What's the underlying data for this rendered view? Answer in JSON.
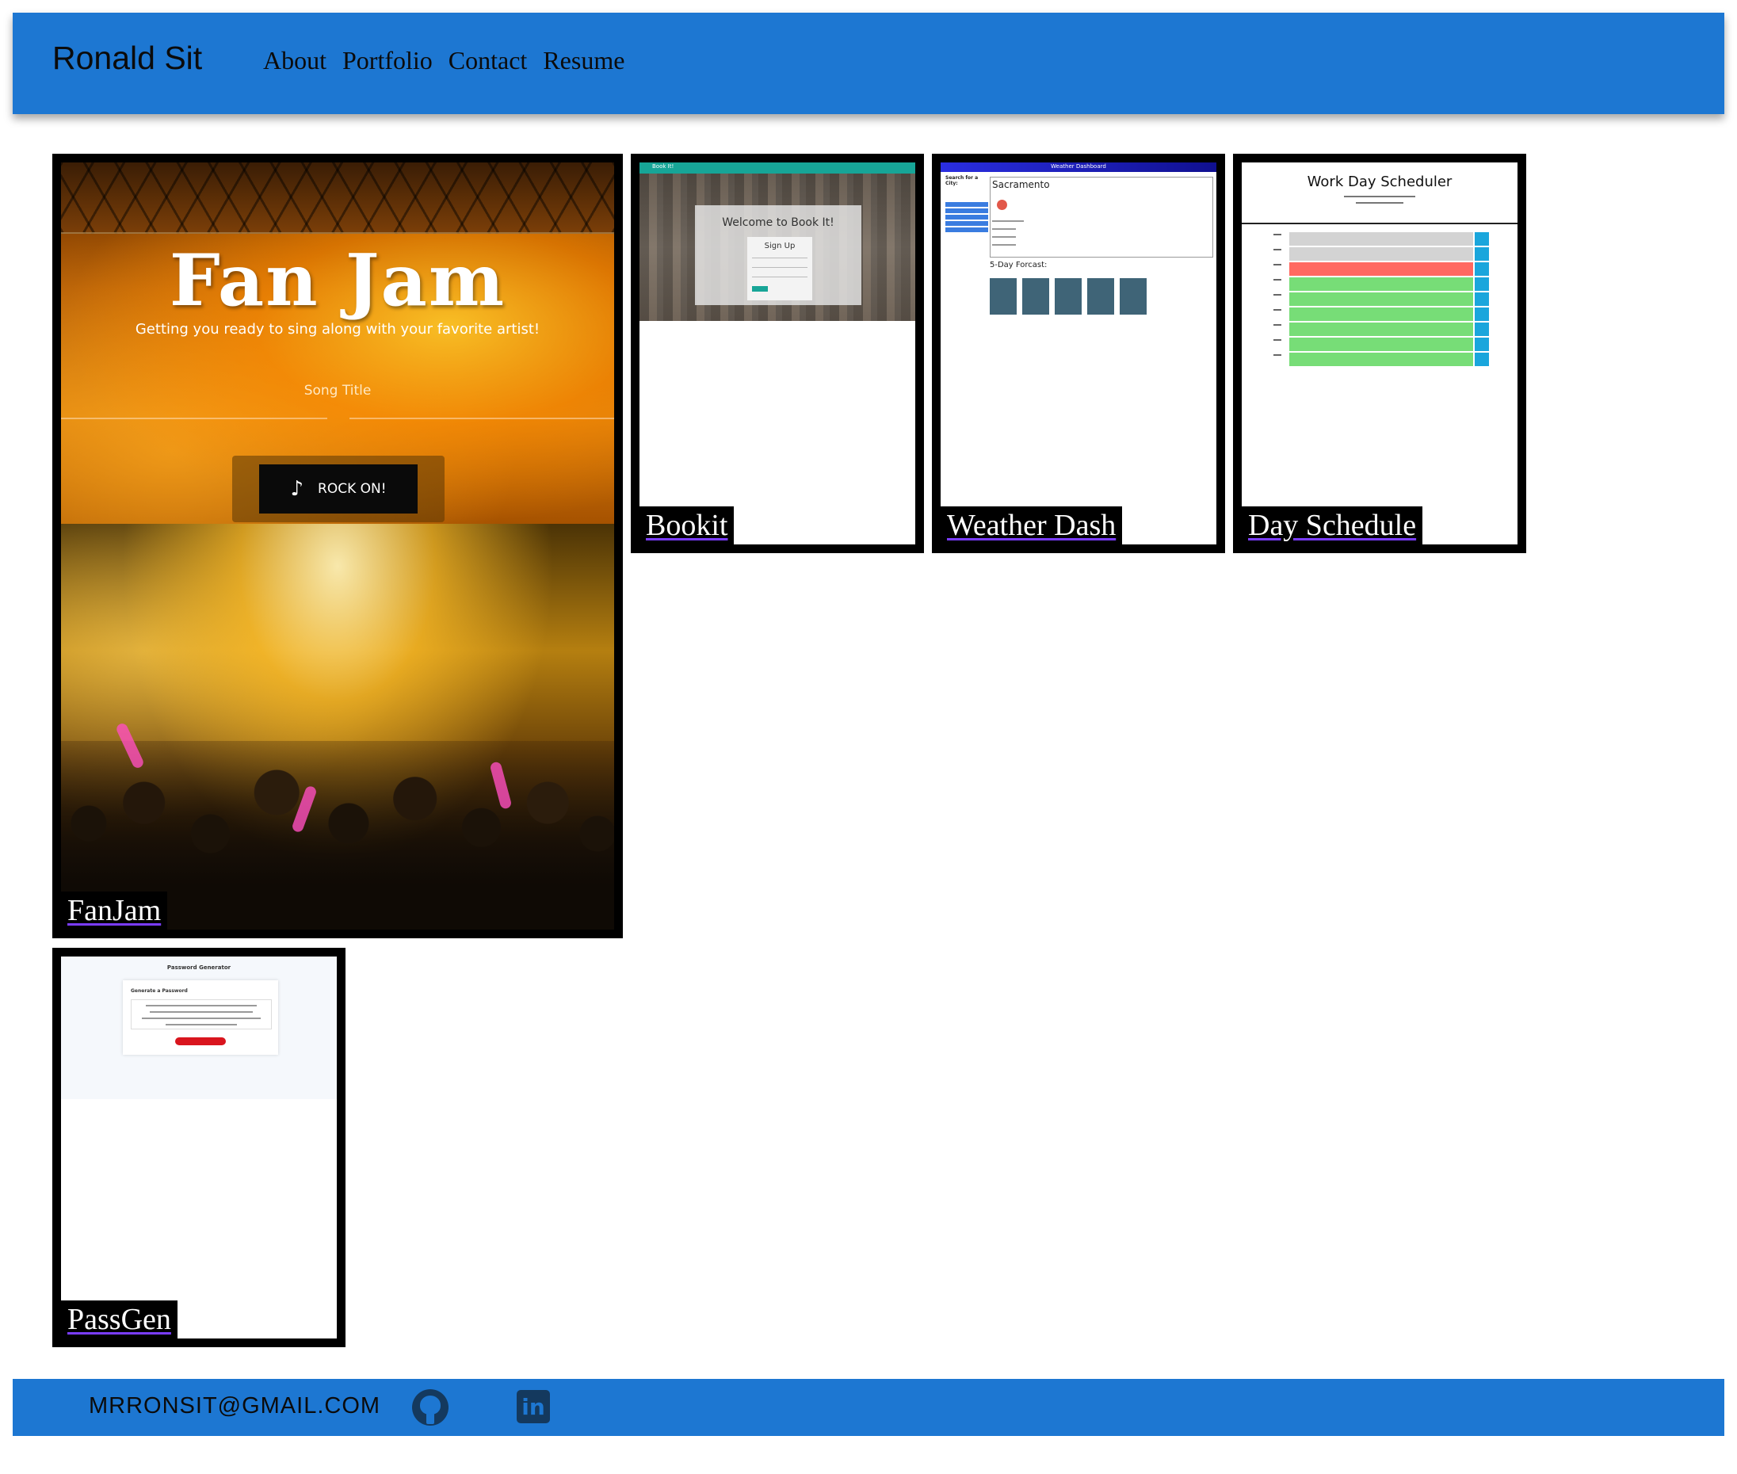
{
  "header": {
    "brand": "Ronald Sit",
    "nav": [
      "About",
      "Portfolio",
      "Contact",
      "Resume"
    ]
  },
  "projects": [
    {
      "label": "FanJam",
      "screenshot": {
        "title": "Fan Jam",
        "subtitle": "Getting you ready to sing along with your favorite artist!",
        "input_placeholder": "Song Title",
        "button": "ROCK ON!"
      }
    },
    {
      "label": "Bookit",
      "screenshot": {
        "nav_brand": "Book It!",
        "heading": "Welcome to Book It!",
        "form_title": "Sign Up"
      }
    },
    {
      "label": "Weather Dash",
      "screenshot": {
        "bar_title": "Weather Dashboard",
        "search_label": "Search for a City:",
        "city": "Sacramento",
        "forecast_heading": "5-Day Forcast:"
      }
    },
    {
      "label": "Day Schedule",
      "screenshot": {
        "title": "Work Day Scheduler",
        "rows": [
          "past",
          "past",
          "present",
          "future",
          "future",
          "future",
          "future",
          "future",
          "future"
        ]
      }
    },
    {
      "label": "PassGen",
      "screenshot": {
        "title": "Password Generator",
        "card_heading": "Generate a Password"
      }
    }
  ],
  "footer": {
    "email": "MRRONSIT@GMAIL.COM",
    "icons": [
      "github-icon",
      "linkedin-icon"
    ],
    "linkedin_glyph": "in"
  },
  "colors": {
    "primary": "#1d77d2",
    "card_border": "#000000",
    "label_bg": "#000000"
  }
}
